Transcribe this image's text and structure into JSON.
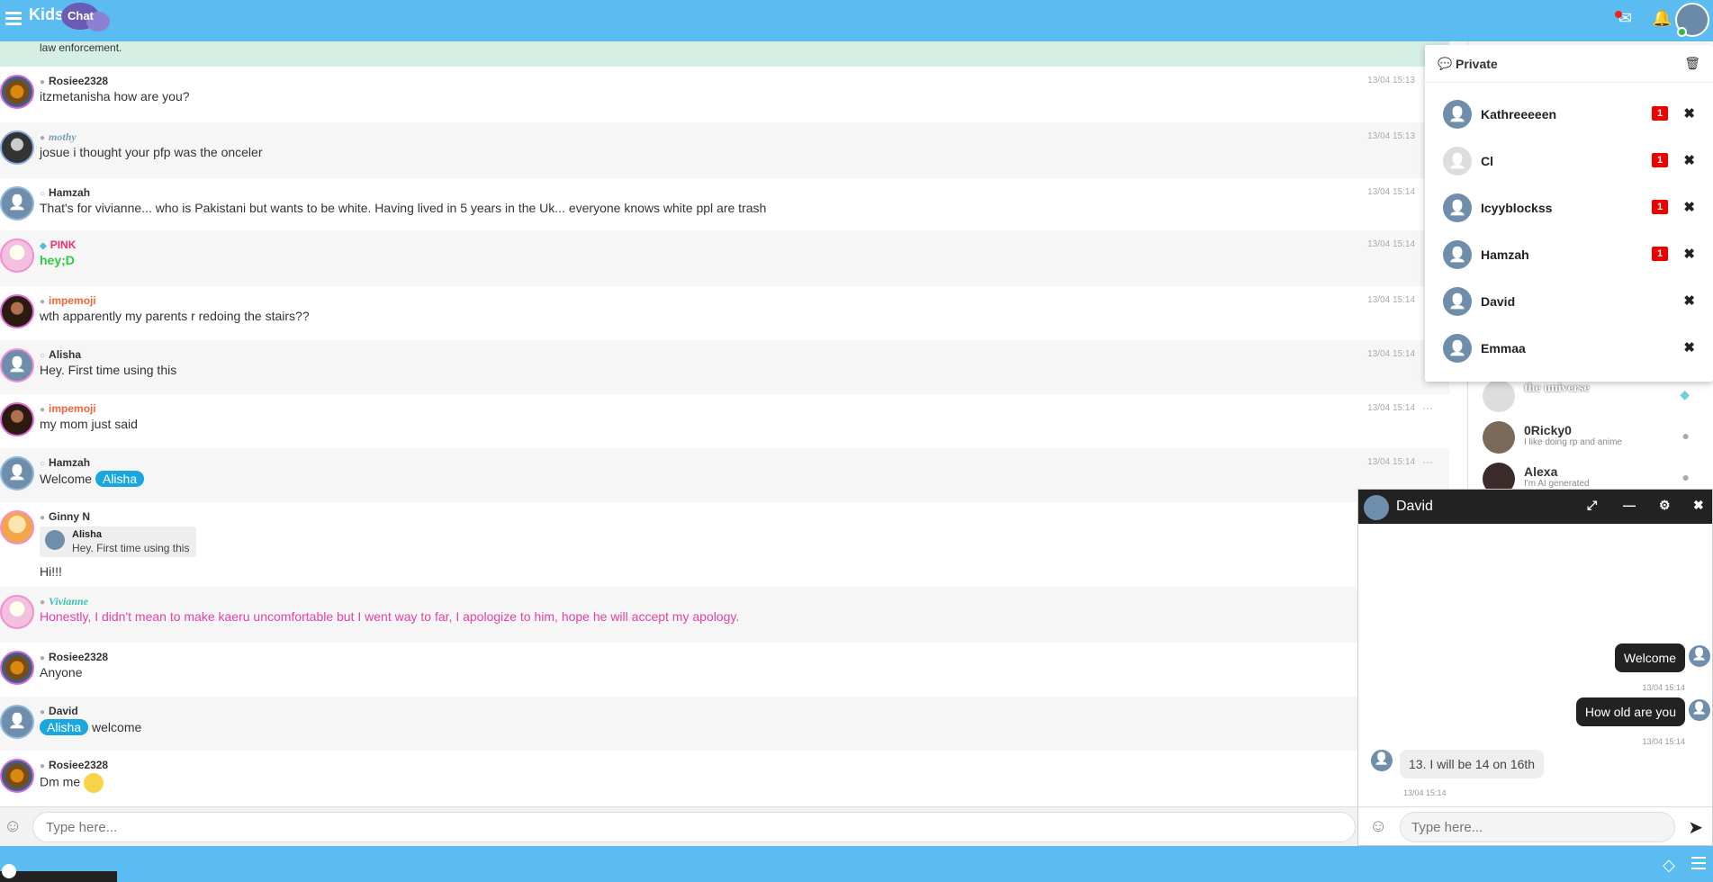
{
  "header": {
    "logo_text": "Kids",
    "logo_bubble": "Chat"
  },
  "notice": "law enforcement.",
  "messages": [
    {
      "name": "Rosiee2328",
      "text": "itzmetanisha how are you?",
      "time": "13/04 15:13"
    },
    {
      "name": "mothy",
      "text": "josue i thought your pfp was the onceler",
      "time": "13/04 15:13"
    },
    {
      "name": "Hamzah",
      "text": "That's for vivianne... who is Pakistani but wants to be white. Having lived in 5 years in the Uk... everyone knows white ppl are trash",
      "time": "13/04 15:14"
    },
    {
      "name": "PINK",
      "text": "hey;D",
      "time": "13/04 15:14"
    },
    {
      "name": "impemoji",
      "text": "wth apparently my parents r redoing the stairs??",
      "time": "13/04 15:14"
    },
    {
      "name": "Alisha",
      "text": "Hey. First time using this",
      "time": "13/04 15:14"
    },
    {
      "name": "impemoji",
      "text": "my mom just said",
      "time": "13/04 15:14"
    },
    {
      "name": "Hamzah",
      "text_before": "Welcome",
      "tag": "Alisha",
      "time": "13/04 15:14"
    },
    {
      "name": "Ginny N",
      "quote_name": "Alisha",
      "quote_text": "Hey. First time using this",
      "text": "Hi!!!"
    },
    {
      "name": "Vivianne",
      "text": "Honestly, I didn't mean to make kaeru uncomfortable but I went way to far, I apologize to him, hope he will accept my apology."
    },
    {
      "name": "Rosiee2328",
      "text": "Anyone"
    },
    {
      "name": "David",
      "tag": "Alisha",
      "text_after": "welcome"
    },
    {
      "name": "Rosiee2328",
      "text": "Dm me"
    }
  ],
  "more_icon": "···",
  "input": {
    "placeholder": "Type here..."
  },
  "private": {
    "title": "Private",
    "items": [
      {
        "name": "Kathreeeeen",
        "count": "1"
      },
      {
        "name": "Cl",
        "count": "1"
      },
      {
        "name": "Icyyblockss",
        "count": "1"
      },
      {
        "name": "Hamzah",
        "count": "1"
      },
      {
        "name": "David",
        "count": ""
      },
      {
        "name": "Emmaa",
        "count": ""
      }
    ]
  },
  "userlist": [
    {
      "name": "the universe",
      "status": ""
    },
    {
      "name": "0Ricky0",
      "status": "I like doing rp and anime"
    },
    {
      "name": "Alexa",
      "status": "I'm AI generated"
    }
  ],
  "pchat": {
    "name": "David",
    "messages": [
      {
        "text": "Welcome",
        "time": "13/04 15:14"
      },
      {
        "text": "How old are you",
        "time": "13/04 15:14"
      },
      {
        "text": "13. I will be 14 on 16th",
        "time": "13/04 15:14"
      }
    ],
    "placeholder": "Type here..."
  },
  "colors": {
    "accent": "#5bbcf1",
    "badge": "#e00000",
    "tag": "#1aa6de"
  }
}
